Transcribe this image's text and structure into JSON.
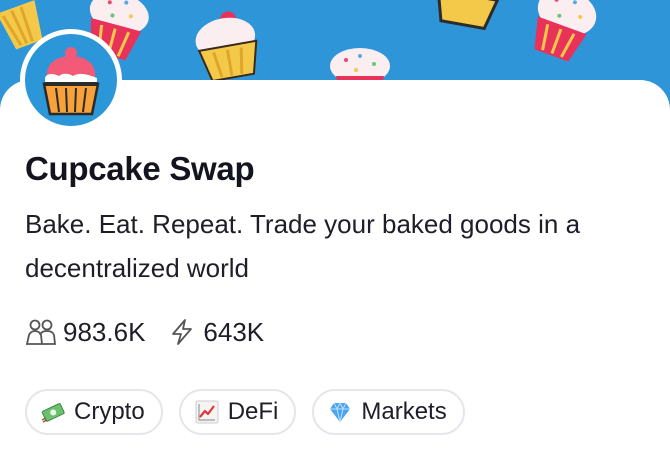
{
  "project": {
    "name": "Cupcake Swap",
    "description": "Bake. Eat. Repeat. Trade your baked goods in a decentralized world"
  },
  "stats": {
    "members": "983.6K",
    "activity": "643K"
  },
  "tags": [
    {
      "label": "Crypto",
      "icon": "money-emoji-icon"
    },
    {
      "label": "DeFi",
      "icon": "chart-increasing-emoji-icon"
    },
    {
      "label": "Markets",
      "icon": "gem-emoji-icon"
    }
  ],
  "colors": {
    "banner": "#2f95d9",
    "avatar_bg": "#2b96d8",
    "text": "#14141f",
    "tag_border": "#e4e6ec"
  }
}
